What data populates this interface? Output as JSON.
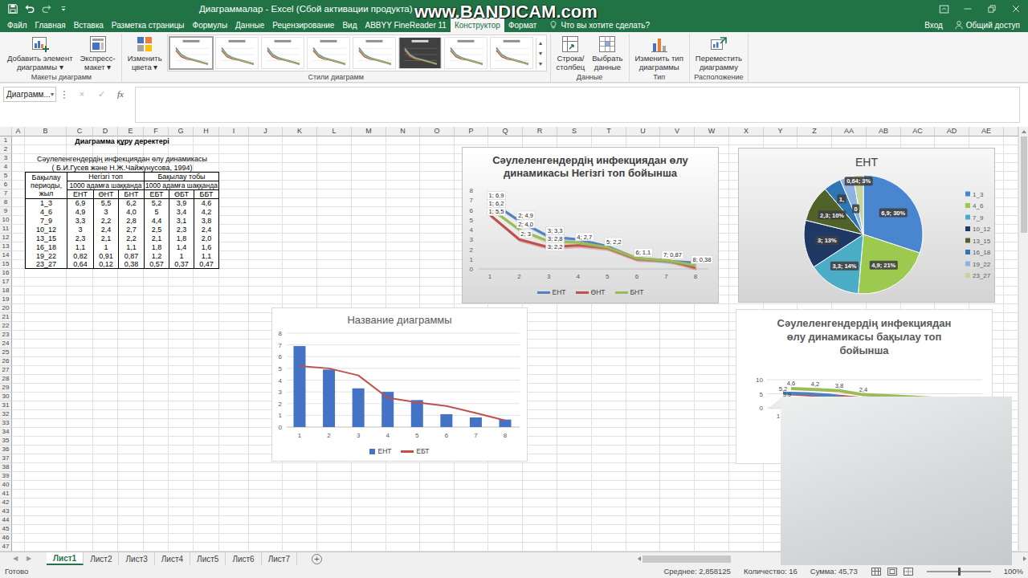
{
  "window": {
    "title": "Диаграммалар - Excel (Сбой активации продукта)",
    "watermark": "www.BANDICAM.com"
  },
  "ribbon_tabs": [
    {
      "label": "Файл",
      "selected": false
    },
    {
      "label": "Главная",
      "selected": false
    },
    {
      "label": "Вставка",
      "selected": false
    },
    {
      "label": "Разметка страницы",
      "selected": false
    },
    {
      "label": "Формулы",
      "selected": false
    },
    {
      "label": "Данные",
      "selected": false
    },
    {
      "label": "Рецензирование",
      "selected": false
    },
    {
      "label": "Вид",
      "selected": false
    },
    {
      "label": "ABBYY FineReader 11",
      "selected": false
    },
    {
      "label": "Конструктор",
      "selected": true
    },
    {
      "label": "Формат",
      "selected": false
    }
  ],
  "tell_me": "Что вы хотите сделать?",
  "account": {
    "sign_in": "Вход",
    "share": "Общий доступ"
  },
  "ribbon": {
    "groups": [
      {
        "label": "Макеты диаграмм",
        "buttons": [
          {
            "kind": "add-element",
            "lines": [
              "Добавить элемент",
              "диаграммы ▾"
            ]
          },
          {
            "kind": "quick-layout",
            "lines": [
              "Экспресс-",
              "макет ▾"
            ]
          }
        ]
      },
      {
        "label": "Стили диаграмм",
        "buttons": [
          {
            "kind": "colors",
            "lines": [
              "Изменить",
              "цвета ▾"
            ]
          }
        ],
        "gallery": {
          "styles": [
            {
              "kind": "light",
              "selected": true
            },
            {
              "kind": "light",
              "selected": false
            },
            {
              "kind": "light",
              "selected": false
            },
            {
              "kind": "light",
              "selected": false
            },
            {
              "kind": "light",
              "selected": false
            },
            {
              "kind": "dark",
              "selected": false
            },
            {
              "kind": "light",
              "selected": false
            },
            {
              "kind": "light",
              "selected": false
            }
          ],
          "scroll": [
            "▴",
            "▾",
            "▾"
          ]
        }
      },
      {
        "label": "Данные",
        "buttons": [
          {
            "kind": "switch",
            "lines": [
              "Строка/",
              "столбец"
            ]
          },
          {
            "kind": "select-data",
            "lines": [
              "Выбрать",
              "данные"
            ]
          }
        ]
      },
      {
        "label": "Тип",
        "buttons": [
          {
            "kind": "change-type",
            "lines": [
              "Изменить тип",
              "диаграммы"
            ]
          }
        ]
      },
      {
        "label": "Расположение",
        "buttons": [
          {
            "kind": "move",
            "lines": [
              "Переместить",
              "диаграмму"
            ]
          }
        ]
      }
    ]
  },
  "formula_bar": {
    "name_box": "Диаграмм...",
    "name_box_arrow": "▾",
    "buttons": [
      {
        "label": "×",
        "disabled": true
      },
      {
        "label": "✓",
        "disabled": true
      },
      {
        "label": "fx",
        "disabled": false
      }
    ]
  },
  "sheet": {
    "columns": [
      "A",
      "B",
      "C",
      "D",
      "E",
      "F",
      "G",
      "H",
      "I",
      "J",
      "K",
      "L",
      "M",
      "N",
      "O",
      "P",
      "Q",
      "R",
      "S",
      "T",
      "U",
      "V",
      "W",
      "X",
      "Y",
      "Z",
      "AA",
      "AB",
      "AC",
      "AD",
      "AE"
    ],
    "rows": [
      "1",
      "2",
      "3",
      "4",
      "5",
      "6",
      "7",
      "8",
      "9",
      "10",
      "11",
      "12",
      "13",
      "14",
      "15",
      "16",
      "17",
      "18",
      "19",
      "20",
      "21",
      "22",
      "23",
      "24",
      "25",
      "26",
      "27",
      "28",
      "29",
      "30",
      "31",
      "32",
      "33",
      "34",
      "35",
      "36",
      "37",
      "38",
      "39",
      "40",
      "41",
      "42",
      "43",
      "44",
      "45",
      "46",
      "47"
    ],
    "title": "Диаграмма құру деректері",
    "caption": "Сәулеленгендердің инфекциядан өлу динамикасы",
    "source": "( Б.И.Гусев және Н.Ж.Чайжунусова, 1994)",
    "table": {
      "period_header": "Бақылау периоды, жыл",
      "groups": [
        {
          "label": "Негізгі топ",
          "unit": "1000 адамға шаққанда",
          "columns": [
            "ЕНТ",
            "ӨНТ",
            "БНТ"
          ]
        },
        {
          "label": "Бақылау тобы",
          "unit": "1000 адамға шаққанда",
          "columns": [
            "ЕБТ",
            "ӨБТ",
            "ББТ"
          ]
        }
      ],
      "rows": [
        [
          "1_3",
          "6,9",
          "5,5",
          "6,2",
          "5,2",
          "3,9",
          "4,6"
        ],
        [
          "4_6",
          "4,9",
          "3",
          "4,0",
          "5",
          "3,4",
          "4,2"
        ],
        [
          "7_9",
          "3,3",
          "2,2",
          "2,8",
          "4,4",
          "3,1",
          "3,8"
        ],
        [
          "10_12",
          "3",
          "2,4",
          "2,7",
          "2,5",
          "2,3",
          "2,4"
        ],
        [
          "13_15",
          "2,3",
          "2,1",
          "2,2",
          "2,1",
          "1,8",
          "2,0"
        ],
        [
          "16_18",
          "1,1",
          "1",
          "1,1",
          "1,8",
          "1,4",
          "1,6"
        ],
        [
          "19_22",
          "0,82",
          "0,91",
          "0,87",
          "1,2",
          "1",
          "1,1"
        ],
        [
          "23_27",
          "0,64",
          "0,12",
          "0,38",
          "0,57",
          "0,37",
          "0,47"
        ]
      ]
    }
  },
  "charts": [
    {
      "kind": "line",
      "title_lines": [
        "Сәулеленгендердің инфекциядан өлу",
        "динамикасы Негізгі топ бойынша"
      ],
      "y_max": 8,
      "y_ticks": [
        "0",
        "1",
        "2",
        "3",
        "4",
        "5",
        "6",
        "7",
        "8"
      ],
      "x_ticks": [
        "1",
        "2",
        "3",
        "4",
        "5",
        "6",
        "7",
        "8"
      ],
      "series": [
        {
          "name": "ЕНТ",
          "color": "#4f81bd",
          "values": [
            6.9,
            4.9,
            3.3,
            3,
            2.3,
            1.1,
            0.82,
            0.64
          ]
        },
        {
          "name": "ӨНТ",
          "color": "#c0504d",
          "values": [
            5.5,
            3,
            2.2,
            2.4,
            2.1,
            1,
            0.91,
            0.12
          ]
        },
        {
          "name": "БНТ",
          "color": "#9bbb59",
          "values": [
            6.2,
            4.0,
            2.8,
            2.7,
            2.2,
            1.1,
            0.87,
            0.38
          ]
        }
      ],
      "data_labels": [
        {
          "series": 0,
          "point": 0,
          "text": "1; 6,9"
        },
        {
          "series": 0,
          "point": 1,
          "text": "2; 4,9"
        },
        {
          "series": 0,
          "point": 2,
          "text": "3; 3,3"
        },
        {
          "series": 1,
          "point": 0,
          "text": "1; 5,5"
        },
        {
          "series": 1,
          "point": 1,
          "text": "2; 3"
        },
        {
          "series": 1,
          "point": 2,
          "text": "3; 2,2"
        },
        {
          "series": 2,
          "point": 0,
          "text": "1; 6,2"
        },
        {
          "series": 2,
          "point": 1,
          "text": "2; 4,0"
        },
        {
          "series": 2,
          "point": 2,
          "text": "3; 2,8"
        },
        {
          "series": 2,
          "point": 3,
          "text": "4; 2,7"
        },
        {
          "series": 2,
          "point": 4,
          "text": "5; 2,2"
        },
        {
          "series": 2,
          "point": 5,
          "text": "6; 1,1"
        },
        {
          "series": 2,
          "point": 6,
          "text": "7; 0,87"
        },
        {
          "series": 2,
          "point": 7,
          "text": "8; 0,38"
        }
      ]
    },
    {
      "kind": "pie",
      "title": "ЕНТ",
      "slices": [
        {
          "label": "1_3",
          "value": 6.9,
          "color": "#4a86d0",
          "data_label": "6,9; 30%"
        },
        {
          "label": "4_6",
          "value": 4.9,
          "color": "#9ec94f",
          "data_label": "4,9; 21%"
        },
        {
          "label": "7_9",
          "value": 3.3,
          "color": "#4bacc6",
          "data_label": "3,3; 14%"
        },
        {
          "label": "10_12",
          "value": 3,
          "color": "#1f3864",
          "data_label": "3; 13%"
        },
        {
          "label": "13_15",
          "value": 2.3,
          "color": "#4f6228",
          "data_label": "2,3; 10%"
        },
        {
          "label": "16_18",
          "value": 1.1,
          "color": "#2e75b6",
          "data_label": "1,"
        },
        {
          "label": "19_22",
          "value": 0.82,
          "color": "#8db3e2",
          "data_label": "0"
        },
        {
          "label": "23_27",
          "value": 0.64,
          "color": "#c3d69b",
          "data_label": "0,64; 3%"
        }
      ]
    },
    {
      "kind": "combo",
      "title": "Название диаграммы",
      "y_max": 8,
      "y_ticks": [
        "0",
        "1",
        "2",
        "3",
        "4",
        "5",
        "6",
        "7",
        "8"
      ],
      "x_ticks": [
        "1",
        "2",
        "3",
        "4",
        "5",
        "6",
        "7",
        "8"
      ],
      "series": [
        {
          "name": "ЕНТ",
          "kind": "bar",
          "color": "#4472c4",
          "values": [
            6.9,
            4.9,
            3.3,
            3,
            2.3,
            1.1,
            0.82,
            0.64
          ]
        },
        {
          "name": "ЕБТ",
          "kind": "line",
          "color": "#c0504d",
          "values": [
            5.2,
            5,
            4.4,
            2.5,
            2.1,
            1.8,
            1.2,
            0.57
          ]
        }
      ]
    },
    {
      "kind": "line3d",
      "title_lines": [
        "Сәулеленгендердің инфекциядан",
        "өлу динамикасы бақылау топ",
        "бойынша"
      ],
      "y_max": 10,
      "y_ticks": [
        "0",
        "5",
        "10"
      ],
      "x_ticks": [
        "1"
      ],
      "series": [
        {
          "color": "#4f81bd",
          "values": [
            5.2,
            5,
            4.4,
            2.5,
            2.1,
            1.8,
            1.2,
            0.57
          ]
        },
        {
          "color": "#c0504d",
          "values": [
            3.9,
            3.4,
            3.1,
            2.3,
            1.8,
            1.4,
            1,
            0.37
          ]
        },
        {
          "color": "#9bbb59",
          "values": [
            4.6,
            4.2,
            3.8,
            2.4,
            2.0,
            1.6,
            1.1,
            0.47
          ]
        }
      ],
      "data_labels": [
        {
          "series": 0,
          "point": 0,
          "text": "5,2"
        },
        {
          "series": 1,
          "point": 0,
          "text": "3,9"
        },
        {
          "series": 2,
          "point": 0,
          "text": "4,6"
        },
        {
          "series": 2,
          "point": 1,
          "text": "4,2"
        },
        {
          "series": 2,
          "point": 2,
          "text": "3,8"
        },
        {
          "series": 2,
          "point": 3,
          "text": "2,4"
        }
      ]
    }
  ],
  "scrollbars": {
    "vertical": 0,
    "horizontal": 0
  },
  "sheet_tabs": {
    "nav": [
      "◀",
      "▶"
    ],
    "tabs": [
      {
        "label": "Лист1",
        "selected": true
      },
      {
        "label": "Лист2",
        "selected": false
      },
      {
        "label": "Лист3",
        "selected": false
      },
      {
        "label": "Лист4",
        "selected": false
      },
      {
        "label": "Лист5",
        "selected": false
      },
      {
        "label": "Лист6",
        "selected": false
      },
      {
        "label": "Лист7",
        "selected": false
      }
    ],
    "add": "+"
  },
  "status_bar": {
    "ready": "Готово",
    "stats": [
      "Среднее: 2,858125",
      "Количество: 16",
      "Сумма: 45,73"
    ],
    "zoom": "100%",
    "zoom_level": 0.5
  }
}
